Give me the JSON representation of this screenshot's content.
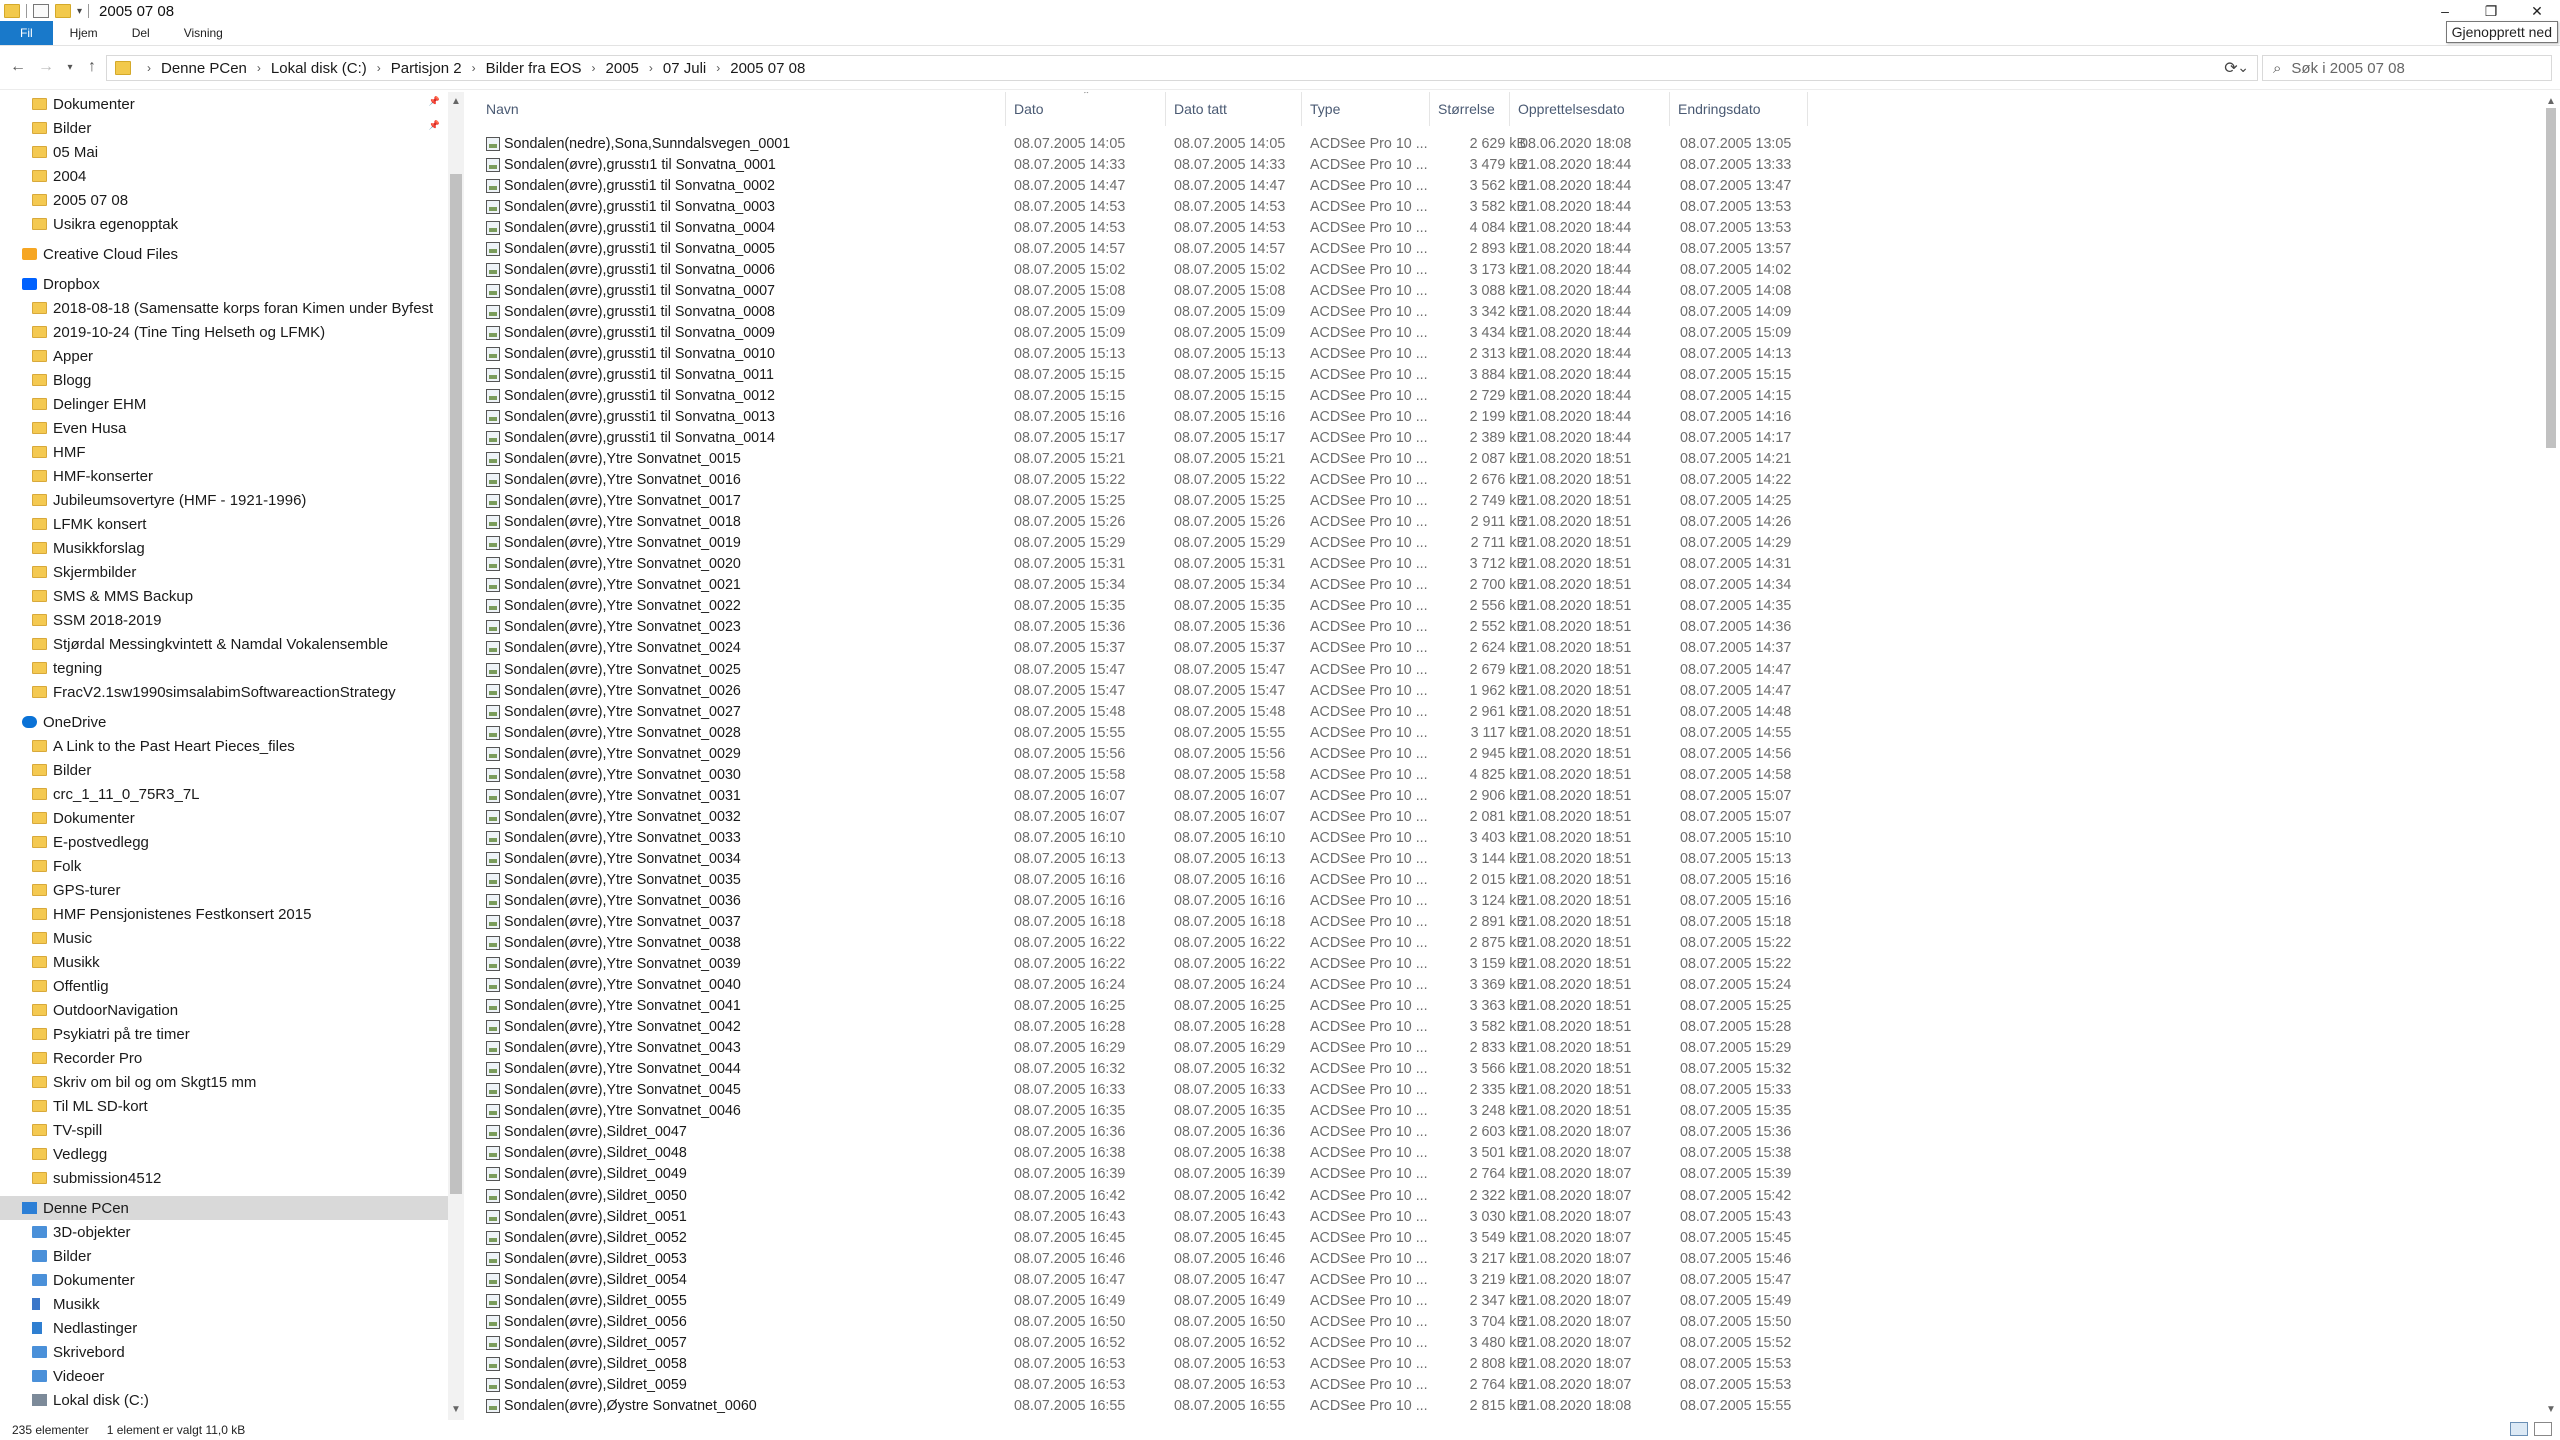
{
  "window": {
    "title": "2005 07 08",
    "controls": {
      "minimize": "–",
      "restore": "❐",
      "close": "✕"
    },
    "tooltip": "Gjenopprett ned"
  },
  "ribbon": {
    "tabs": [
      "Fil",
      "Hjem",
      "Del",
      "Visning"
    ]
  },
  "address": {
    "crumbs": [
      "Denne PCen",
      "Lokal disk (C:)",
      "Partisjon 2",
      "Bilder fra EOS",
      "2005",
      "07 Juli",
      "2005 07 08"
    ],
    "search_placeholder": "Søk i 2005 07 08"
  },
  "nav": {
    "items": [
      {
        "label": "Dokumenter",
        "icon": "folder-icon",
        "indent": 1,
        "pinned": true
      },
      {
        "label": "Bilder",
        "icon": "folder-icon",
        "indent": 1,
        "pinned": true
      },
      {
        "label": "05 Mai",
        "icon": "folder-icon",
        "indent": 1
      },
      {
        "label": "2004",
        "icon": "folder-icon",
        "indent": 1
      },
      {
        "label": "2005 07 08",
        "icon": "folder-icon",
        "indent": 1
      },
      {
        "label": "Usikra egenopptak",
        "icon": "folder-icon",
        "indent": 1
      },
      {
        "label": "",
        "icon": "",
        "indent": 0,
        "spacer": true
      },
      {
        "label": "Creative Cloud Files",
        "icon": "creative-cloud-icon",
        "indent": 0
      },
      {
        "label": "",
        "icon": "",
        "indent": 0,
        "spacer": true
      },
      {
        "label": "Dropbox",
        "icon": "dropbox-icon",
        "indent": 0
      },
      {
        "label": "2018-08-18 (Samensatte korps foran Kimen under Byfest",
        "icon": "folder-icon",
        "indent": 1
      },
      {
        "label": "2019-10-24 (Tine Ting Helseth og LFMK)",
        "icon": "folder-icon",
        "indent": 1
      },
      {
        "label": "Apper",
        "icon": "folder-icon",
        "indent": 1
      },
      {
        "label": "Blogg",
        "icon": "folder-icon",
        "indent": 1
      },
      {
        "label": "Delinger EHM",
        "icon": "folder-icon",
        "indent": 1
      },
      {
        "label": "Even Husa",
        "icon": "folder-icon",
        "indent": 1
      },
      {
        "label": "HMF",
        "icon": "folder-icon",
        "indent": 1
      },
      {
        "label": "HMF-konserter",
        "icon": "folder-icon",
        "indent": 1
      },
      {
        "label": "Jubileumsovertyre (HMF - 1921-1996)",
        "icon": "folder-icon",
        "indent": 1
      },
      {
        "label": "LFMK konsert",
        "icon": "folder-icon",
        "indent": 1
      },
      {
        "label": "Musikkforslag",
        "icon": "folder-icon",
        "indent": 1
      },
      {
        "label": "Skjermbilder",
        "icon": "folder-icon",
        "indent": 1
      },
      {
        "label": "SMS & MMS Backup",
        "icon": "folder-icon",
        "indent": 1
      },
      {
        "label": "SSM 2018-2019",
        "icon": "folder-icon",
        "indent": 1
      },
      {
        "label": "Stjørdal Messingkvintett & Namdal Vokalensemble",
        "icon": "folder-icon",
        "indent": 1
      },
      {
        "label": "tegning",
        "icon": "folder-icon",
        "indent": 1
      },
      {
        "label": "FracV2.1sw1990simsalabimSoftwareactionStrategy",
        "icon": "file-icon",
        "indent": 1
      },
      {
        "label": "",
        "icon": "",
        "indent": 0,
        "spacer": true
      },
      {
        "label": "OneDrive",
        "icon": "onedrive-icon",
        "indent": 0
      },
      {
        "label": "A Link to the Past Heart Pieces_files",
        "icon": "folder-icon",
        "indent": 1
      },
      {
        "label": "Bilder",
        "icon": "folder-icon",
        "indent": 1
      },
      {
        "label": "crc_1_11_0_75R3_7L",
        "icon": "folder-icon",
        "indent": 1
      },
      {
        "label": "Dokumenter",
        "icon": "folder-icon",
        "indent": 1
      },
      {
        "label": "E-postvedlegg",
        "icon": "folder-icon",
        "indent": 1
      },
      {
        "label": "Folk",
        "icon": "folder-icon",
        "indent": 1
      },
      {
        "label": "GPS-turer",
        "icon": "folder-icon",
        "indent": 1
      },
      {
        "label": "HMF Pensjonistenes Festkonsert 2015",
        "icon": "folder-icon",
        "indent": 1
      },
      {
        "label": "Music",
        "icon": "folder-icon",
        "indent": 1
      },
      {
        "label": "Musikk",
        "icon": "folder-icon",
        "indent": 1
      },
      {
        "label": "Offentlig",
        "icon": "folder-icon",
        "indent": 1
      },
      {
        "label": "OutdoorNavigation",
        "icon": "folder-icon",
        "indent": 1
      },
      {
        "label": "Psykiatri på tre timer",
        "icon": "folder-icon",
        "indent": 1
      },
      {
        "label": "Recorder Pro",
        "icon": "folder-icon",
        "indent": 1
      },
      {
        "label": "Skriv om bil og om Skgt15 mm",
        "icon": "folder-icon",
        "indent": 1
      },
      {
        "label": "Til ML SD-kort",
        "icon": "folder-icon",
        "indent": 1
      },
      {
        "label": "TV-spill",
        "icon": "folder-icon",
        "indent": 1
      },
      {
        "label": "Vedlegg",
        "icon": "folder-icon",
        "indent": 1
      },
      {
        "label": "submission4512",
        "icon": "file-icon",
        "indent": 1
      },
      {
        "label": "",
        "icon": "",
        "indent": 0,
        "spacer": true
      },
      {
        "label": "Denne PCen",
        "icon": "computer-icon",
        "indent": 0,
        "selected": true
      },
      {
        "label": "3D-objekter",
        "icon": "cube-icon",
        "indent": 1
      },
      {
        "label": "Bilder",
        "icon": "pictures-icon",
        "indent": 1
      },
      {
        "label": "Dokumenter",
        "icon": "documents-icon",
        "indent": 1
      },
      {
        "label": "Musikk",
        "icon": "music-icon",
        "indent": 1
      },
      {
        "label": "Nedlastinger",
        "icon": "download-icon",
        "indent": 1
      },
      {
        "label": "Skrivebord",
        "icon": "desktop-icon",
        "indent": 1
      },
      {
        "label": "Videoer",
        "icon": "video-icon",
        "indent": 1
      },
      {
        "label": "Lokal disk (C:)",
        "icon": "drive-icon",
        "indent": 1
      }
    ]
  },
  "columns": [
    "Navn",
    "Dato",
    "Dato tatt",
    "Type",
    "Størrelse",
    "Opprettelsesdato",
    "Endringsdato"
  ],
  "files": [
    [
      "Sondalen(nedre),Sona,Sunndalsvegen_0001",
      "08.07.2005 14:05",
      "08.07.2005 14:05",
      "ACDSee Pro 10 ...",
      "2 629 kB",
      "08.06.2020 18:08",
      "08.07.2005 13:05"
    ],
    [
      "Sondalen(øvre),grusstı1 til Sonvatna_0001",
      "08.07.2005 14:33",
      "08.07.2005 14:33",
      "ACDSee Pro 10 ...",
      "3 479 kB",
      "21.08.2020 18:44",
      "08.07.2005 13:33"
    ],
    [
      "Sondalen(øvre),grussti1 til Sonvatna_0002",
      "08.07.2005 14:47",
      "08.07.2005 14:47",
      "ACDSee Pro 10 ...",
      "3 562 kB",
      "21.08.2020 18:44",
      "08.07.2005 13:47"
    ],
    [
      "Sondalen(øvre),grussti1 til Sonvatna_0003",
      "08.07.2005 14:53",
      "08.07.2005 14:53",
      "ACDSee Pro 10 ...",
      "3 582 kB",
      "21.08.2020 18:44",
      "08.07.2005 13:53"
    ],
    [
      "Sondalen(øvre),grussti1 til Sonvatna_0004",
      "08.07.2005 14:53",
      "08.07.2005 14:53",
      "ACDSee Pro 10 ...",
      "4 084 kB",
      "21.08.2020 18:44",
      "08.07.2005 13:53"
    ],
    [
      "Sondalen(øvre),grussti1 til Sonvatna_0005",
      "08.07.2005 14:57",
      "08.07.2005 14:57",
      "ACDSee Pro 10 ...",
      "2 893 kB",
      "21.08.2020 18:44",
      "08.07.2005 13:57"
    ],
    [
      "Sondalen(øvre),grussti1 til Sonvatna_0006",
      "08.07.2005 15:02",
      "08.07.2005 15:02",
      "ACDSee Pro 10 ...",
      "3 173 kB",
      "21.08.2020 18:44",
      "08.07.2005 14:02"
    ],
    [
      "Sondalen(øvre),grussti1 til Sonvatna_0007",
      "08.07.2005 15:08",
      "08.07.2005 15:08",
      "ACDSee Pro 10 ...",
      "3 088 kB",
      "21.08.2020 18:44",
      "08.07.2005 14:08"
    ],
    [
      "Sondalen(øvre),grussti1 til Sonvatna_0008",
      "08.07.2005 15:09",
      "08.07.2005 15:09",
      "ACDSee Pro 10 ...",
      "3 342 kB",
      "21.08.2020 18:44",
      "08.07.2005 14:09"
    ],
    [
      "Sondalen(øvre),grussti1 til Sonvatna_0009",
      "08.07.2005 15:09",
      "08.07.2005 15:09",
      "ACDSee Pro 10 ...",
      "3 434 kB",
      "21.08.2020 18:44",
      "08.07.2005 15:09"
    ],
    [
      "Sondalen(øvre),grussti1 til Sonvatna_0010",
      "08.07.2005 15:13",
      "08.07.2005 15:13",
      "ACDSee Pro 10 ...",
      "2 313 kB",
      "21.08.2020 18:44",
      "08.07.2005 14:13"
    ],
    [
      "Sondalen(øvre),grussti1 til Sonvatna_0011",
      "08.07.2005 15:15",
      "08.07.2005 15:15",
      "ACDSee Pro 10 ...",
      "3 884 kB",
      "21.08.2020 18:44",
      "08.07.2005 15:15"
    ],
    [
      "Sondalen(øvre),grussti1 til Sonvatna_0012",
      "08.07.2005 15:15",
      "08.07.2005 15:15",
      "ACDSee Pro 10 ...",
      "2 729 kB",
      "21.08.2020 18:44",
      "08.07.2005 14:15"
    ],
    [
      "Sondalen(øvre),grussti1 til Sonvatna_0013",
      "08.07.2005 15:16",
      "08.07.2005 15:16",
      "ACDSee Pro 10 ...",
      "2 199 kB",
      "21.08.2020 18:44",
      "08.07.2005 14:16"
    ],
    [
      "Sondalen(øvre),grussti1 til Sonvatna_0014",
      "08.07.2005 15:17",
      "08.07.2005 15:17",
      "ACDSee Pro 10 ...",
      "2 389 kB",
      "21.08.2020 18:44",
      "08.07.2005 14:17"
    ],
    [
      "Sondalen(øvre),Ytre Sonvatnet_0015",
      "08.07.2005 15:21",
      "08.07.2005 15:21",
      "ACDSee Pro 10 ...",
      "2 087 kB",
      "21.08.2020 18:51",
      "08.07.2005 14:21"
    ],
    [
      "Sondalen(øvre),Ytre Sonvatnet_0016",
      "08.07.2005 15:22",
      "08.07.2005 15:22",
      "ACDSee Pro 10 ...",
      "2 676 kB",
      "21.08.2020 18:51",
      "08.07.2005 14:22"
    ],
    [
      "Sondalen(øvre),Ytre Sonvatnet_0017",
      "08.07.2005 15:25",
      "08.07.2005 15:25",
      "ACDSee Pro 10 ...",
      "2 749 kB",
      "21.08.2020 18:51",
      "08.07.2005 14:25"
    ],
    [
      "Sondalen(øvre),Ytre Sonvatnet_0018",
      "08.07.2005 15:26",
      "08.07.2005 15:26",
      "ACDSee Pro 10 ...",
      "2 911 kB",
      "21.08.2020 18:51",
      "08.07.2005 14:26"
    ],
    [
      "Sondalen(øvre),Ytre Sonvatnet_0019",
      "08.07.2005 15:29",
      "08.07.2005 15:29",
      "ACDSee Pro 10 ...",
      "2 711 kB",
      "21.08.2020 18:51",
      "08.07.2005 14:29"
    ],
    [
      "Sondalen(øvre),Ytre Sonvatnet_0020",
      "08.07.2005 15:31",
      "08.07.2005 15:31",
      "ACDSee Pro 10 ...",
      "3 712 kB",
      "21.08.2020 18:51",
      "08.07.2005 14:31"
    ],
    [
      "Sondalen(øvre),Ytre Sonvatnet_0021",
      "08.07.2005 15:34",
      "08.07.2005 15:34",
      "ACDSee Pro 10 ...",
      "2 700 kB",
      "21.08.2020 18:51",
      "08.07.2005 14:34"
    ],
    [
      "Sondalen(øvre),Ytre Sonvatnet_0022",
      "08.07.2005 15:35",
      "08.07.2005 15:35",
      "ACDSee Pro 10 ...",
      "2 556 kB",
      "21.08.2020 18:51",
      "08.07.2005 14:35"
    ],
    [
      "Sondalen(øvre),Ytre Sonvatnet_0023",
      "08.07.2005 15:36",
      "08.07.2005 15:36",
      "ACDSee Pro 10 ...",
      "2 552 kB",
      "21.08.2020 18:51",
      "08.07.2005 14:36"
    ],
    [
      "Sondalen(øvre),Ytre Sonvatnet_0024",
      "08.07.2005 15:37",
      "08.07.2005 15:37",
      "ACDSee Pro 10 ...",
      "2 624 kB",
      "21.08.2020 18:51",
      "08.07.2005 14:37"
    ],
    [
      "Sondalen(øvre),Ytre Sonvatnet_0025",
      "08.07.2005 15:47",
      "08.07.2005 15:47",
      "ACDSee Pro 10 ...",
      "2 679 kB",
      "21.08.2020 18:51",
      "08.07.2005 14:47"
    ],
    [
      "Sondalen(øvre),Ytre Sonvatnet_0026",
      "08.07.2005 15:47",
      "08.07.2005 15:47",
      "ACDSee Pro 10 ...",
      "1 962 kB",
      "21.08.2020 18:51",
      "08.07.2005 14:47"
    ],
    [
      "Sondalen(øvre),Ytre Sonvatnet_0027",
      "08.07.2005 15:48",
      "08.07.2005 15:48",
      "ACDSee Pro 10 ...",
      "2 961 kB",
      "21.08.2020 18:51",
      "08.07.2005 14:48"
    ],
    [
      "Sondalen(øvre),Ytre Sonvatnet_0028",
      "08.07.2005 15:55",
      "08.07.2005 15:55",
      "ACDSee Pro 10 ...",
      "3 117 kB",
      "21.08.2020 18:51",
      "08.07.2005 14:55"
    ],
    [
      "Sondalen(øvre),Ytre Sonvatnet_0029",
      "08.07.2005 15:56",
      "08.07.2005 15:56",
      "ACDSee Pro 10 ...",
      "2 945 kB",
      "21.08.2020 18:51",
      "08.07.2005 14:56"
    ],
    [
      "Sondalen(øvre),Ytre Sonvatnet_0030",
      "08.07.2005 15:58",
      "08.07.2005 15:58",
      "ACDSee Pro 10 ...",
      "4 825 kB",
      "21.08.2020 18:51",
      "08.07.2005 14:58"
    ],
    [
      "Sondalen(øvre),Ytre Sonvatnet_0031",
      "08.07.2005 16:07",
      "08.07.2005 16:07",
      "ACDSee Pro 10 ...",
      "2 906 kB",
      "21.08.2020 18:51",
      "08.07.2005 15:07"
    ],
    [
      "Sondalen(øvre),Ytre Sonvatnet_0032",
      "08.07.2005 16:07",
      "08.07.2005 16:07",
      "ACDSee Pro 10 ...",
      "2 081 kB",
      "21.08.2020 18:51",
      "08.07.2005 15:07"
    ],
    [
      "Sondalen(øvre),Ytre Sonvatnet_0033",
      "08.07.2005 16:10",
      "08.07.2005 16:10",
      "ACDSee Pro 10 ...",
      "3 403 kB",
      "21.08.2020 18:51",
      "08.07.2005 15:10"
    ],
    [
      "Sondalen(øvre),Ytre Sonvatnet_0034",
      "08.07.2005 16:13",
      "08.07.2005 16:13",
      "ACDSee Pro 10 ...",
      "3 144 kB",
      "21.08.2020 18:51",
      "08.07.2005 15:13"
    ],
    [
      "Sondalen(øvre),Ytre Sonvatnet_0035",
      "08.07.2005 16:16",
      "08.07.2005 16:16",
      "ACDSee Pro 10 ...",
      "2 015 kB",
      "21.08.2020 18:51",
      "08.07.2005 15:16"
    ],
    [
      "Sondalen(øvre),Ytre Sonvatnet_0036",
      "08.07.2005 16:16",
      "08.07.2005 16:16",
      "ACDSee Pro 10 ...",
      "3 124 kB",
      "21.08.2020 18:51",
      "08.07.2005 15:16"
    ],
    [
      "Sondalen(øvre),Ytre Sonvatnet_0037",
      "08.07.2005 16:18",
      "08.07.2005 16:18",
      "ACDSee Pro 10 ...",
      "2 891 kB",
      "21.08.2020 18:51",
      "08.07.2005 15:18"
    ],
    [
      "Sondalen(øvre),Ytre Sonvatnet_0038",
      "08.07.2005 16:22",
      "08.07.2005 16:22",
      "ACDSee Pro 10 ...",
      "2 875 kB",
      "21.08.2020 18:51",
      "08.07.2005 15:22"
    ],
    [
      "Sondalen(øvre),Ytre Sonvatnet_0039",
      "08.07.2005 16:22",
      "08.07.2005 16:22",
      "ACDSee Pro 10 ...",
      "3 159 kB",
      "21.08.2020 18:51",
      "08.07.2005 15:22"
    ],
    [
      "Sondalen(øvre),Ytre Sonvatnet_0040",
      "08.07.2005 16:24",
      "08.07.2005 16:24",
      "ACDSee Pro 10 ...",
      "3 369 kB",
      "21.08.2020 18:51",
      "08.07.2005 15:24"
    ],
    [
      "Sondalen(øvre),Ytre Sonvatnet_0041",
      "08.07.2005 16:25",
      "08.07.2005 16:25",
      "ACDSee Pro 10 ...",
      "3 363 kB",
      "21.08.2020 18:51",
      "08.07.2005 15:25"
    ],
    [
      "Sondalen(øvre),Ytre Sonvatnet_0042",
      "08.07.2005 16:28",
      "08.07.2005 16:28",
      "ACDSee Pro 10 ...",
      "3 582 kB",
      "21.08.2020 18:51",
      "08.07.2005 15:28"
    ],
    [
      "Sondalen(øvre),Ytre Sonvatnet_0043",
      "08.07.2005 16:29",
      "08.07.2005 16:29",
      "ACDSee Pro 10 ...",
      "2 833 kB",
      "21.08.2020 18:51",
      "08.07.2005 15:29"
    ],
    [
      "Sondalen(øvre),Ytre Sonvatnet_0044",
      "08.07.2005 16:32",
      "08.07.2005 16:32",
      "ACDSee Pro 10 ...",
      "3 566 kB",
      "21.08.2020 18:51",
      "08.07.2005 15:32"
    ],
    [
      "Sondalen(øvre),Ytre Sonvatnet_0045",
      "08.07.2005 16:33",
      "08.07.2005 16:33",
      "ACDSee Pro 10 ...",
      "2 335 kB",
      "21.08.2020 18:51",
      "08.07.2005 15:33"
    ],
    [
      "Sondalen(øvre),Ytre Sonvatnet_0046",
      "08.07.2005 16:35",
      "08.07.2005 16:35",
      "ACDSee Pro 10 ...",
      "3 248 kB",
      "21.08.2020 18:51",
      "08.07.2005 15:35"
    ],
    [
      "Sondalen(øvre),Sildret_0047",
      "08.07.2005 16:36",
      "08.07.2005 16:36",
      "ACDSee Pro 10 ...",
      "2 603 kB",
      "21.08.2020 18:07",
      "08.07.2005 15:36"
    ],
    [
      "Sondalen(øvre),Sildret_0048",
      "08.07.2005 16:38",
      "08.07.2005 16:38",
      "ACDSee Pro 10 ...",
      "3 501 kB",
      "21.08.2020 18:07",
      "08.07.2005 15:38"
    ],
    [
      "Sondalen(øvre),Sildret_0049",
      "08.07.2005 16:39",
      "08.07.2005 16:39",
      "ACDSee Pro 10 ...",
      "2 764 kB",
      "21.08.2020 18:07",
      "08.07.2005 15:39"
    ],
    [
      "Sondalen(øvre),Sildret_0050",
      "08.07.2005 16:42",
      "08.07.2005 16:42",
      "ACDSee Pro 10 ...",
      "2 322 kB",
      "21.08.2020 18:07",
      "08.07.2005 15:42"
    ],
    [
      "Sondalen(øvre),Sildret_0051",
      "08.07.2005 16:43",
      "08.07.2005 16:43",
      "ACDSee Pro 10 ...",
      "3 030 kB",
      "21.08.2020 18:07",
      "08.07.2005 15:43"
    ],
    [
      "Sondalen(øvre),Sildret_0052",
      "08.07.2005 16:45",
      "08.07.2005 16:45",
      "ACDSee Pro 10 ...",
      "3 549 kB",
      "21.08.2020 18:07",
      "08.07.2005 15:45"
    ],
    [
      "Sondalen(øvre),Sildret_0053",
      "08.07.2005 16:46",
      "08.07.2005 16:46",
      "ACDSee Pro 10 ...",
      "3 217 kB",
      "21.08.2020 18:07",
      "08.07.2005 15:46"
    ],
    [
      "Sondalen(øvre),Sildret_0054",
      "08.07.2005 16:47",
      "08.07.2005 16:47",
      "ACDSee Pro 10 ...",
      "3 219 kB",
      "21.08.2020 18:07",
      "08.07.2005 15:47"
    ],
    [
      "Sondalen(øvre),Sildret_0055",
      "08.07.2005 16:49",
      "08.07.2005 16:49",
      "ACDSee Pro 10 ...",
      "2 347 kB",
      "21.08.2020 18:07",
      "08.07.2005 15:49"
    ],
    [
      "Sondalen(øvre),Sildret_0056",
      "08.07.2005 16:50",
      "08.07.2005 16:50",
      "ACDSee Pro 10 ...",
      "3 704 kB",
      "21.08.2020 18:07",
      "08.07.2005 15:50"
    ],
    [
      "Sondalen(øvre),Sildret_0057",
      "08.07.2005 16:52",
      "08.07.2005 16:52",
      "ACDSee Pro 10 ...",
      "3 480 kB",
      "21.08.2020 18:07",
      "08.07.2005 15:52"
    ],
    [
      "Sondalen(øvre),Sildret_0058",
      "08.07.2005 16:53",
      "08.07.2005 16:53",
      "ACDSee Pro 10 ...",
      "2 808 kB",
      "21.08.2020 18:07",
      "08.07.2005 15:53"
    ],
    [
      "Sondalen(øvre),Sildret_0059",
      "08.07.2005 16:53",
      "08.07.2005 16:53",
      "ACDSee Pro 10 ...",
      "2 764 kB",
      "21.08.2020 18:07",
      "08.07.2005 15:53"
    ],
    [
      "Sondalen(øvre),Øystre Sonvatnet_0060",
      "08.07.2005 16:55",
      "08.07.2005 16:55",
      "ACDSee Pro 10 ...",
      "2 815 kB",
      "21.08.2020 18:08",
      "08.07.2005 15:55"
    ]
  ],
  "status": {
    "count": "235 elementer",
    "selected": "1 element er valgt  11,0 kB"
  },
  "colors": {
    "accent": "#1979ca",
    "folder": "#f4c951",
    "header_text": "#4a5a73",
    "selected_nav": "#d9d9d9"
  }
}
